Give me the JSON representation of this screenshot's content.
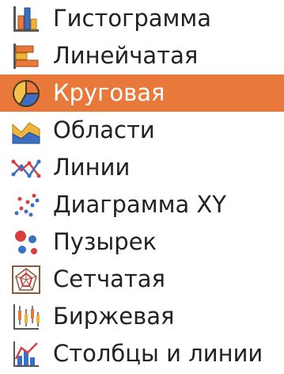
{
  "chart_type_list": {
    "selected_index": 2,
    "colors": {
      "selected_bg": "#e8793a",
      "text": "#222222",
      "selected_text": "#ffffff"
    },
    "items": [
      {
        "label": "Гистограмма",
        "icon": "column-chart-icon"
      },
      {
        "label": "Линейчатая",
        "icon": "bar-chart-icon"
      },
      {
        "label": "Круговая",
        "icon": "pie-chart-icon"
      },
      {
        "label": "Области",
        "icon": "area-chart-icon"
      },
      {
        "label": "Линии",
        "icon": "line-chart-icon"
      },
      {
        "label": "Диаграмма XY",
        "icon": "xy-scatter-chart-icon"
      },
      {
        "label": "Пузырек",
        "icon": "bubble-chart-icon"
      },
      {
        "label": "Сетчатая",
        "icon": "net-chart-icon"
      },
      {
        "label": "Биржевая",
        "icon": "stock-chart-icon"
      },
      {
        "label": "Столбцы и линии",
        "icon": "column-and-line-chart-icon"
      }
    ]
  }
}
